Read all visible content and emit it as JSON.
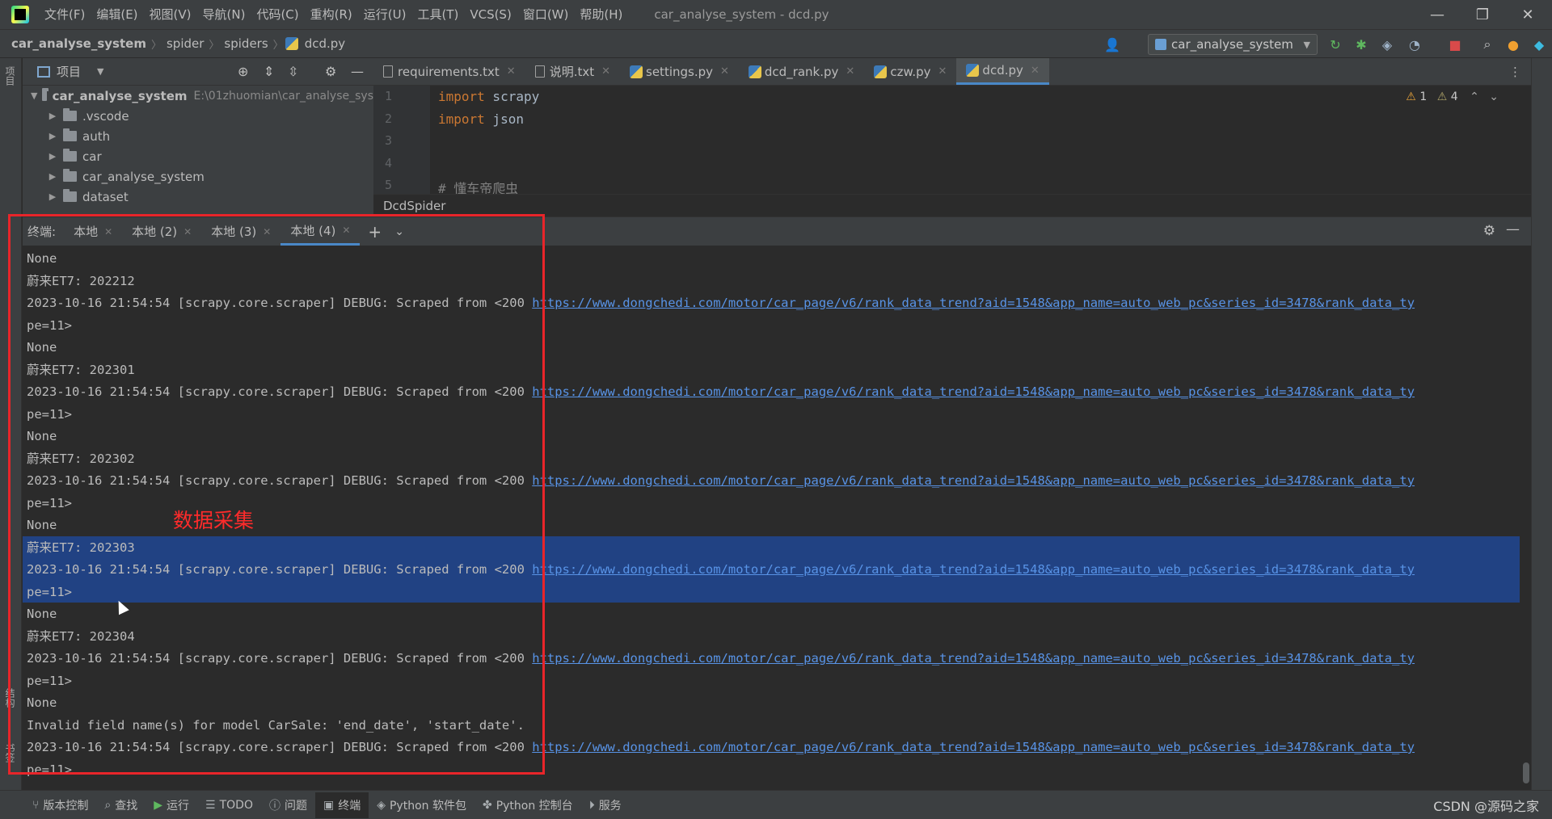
{
  "menu": {
    "items": [
      "文件(F)",
      "编辑(E)",
      "视图(V)",
      "导航(N)",
      "代码(C)",
      "重构(R)",
      "运行(U)",
      "工具(T)",
      "VCS(S)",
      "窗口(W)",
      "帮助(H)"
    ],
    "window_title": "car_analyse_system - dcd.py"
  },
  "nav": {
    "crumbs": [
      "car_analyse_system",
      "spider",
      "spiders",
      "dcd.py"
    ],
    "run_config": "car_analyse_system"
  },
  "left_strip": {
    "top_label": "项目",
    "bottom_label_1": "结构",
    "bottom_label_2": "书签"
  },
  "project": {
    "header_label": "项目",
    "root": {
      "name": "car_analyse_system",
      "path": "E:\\01zhuomian\\car_analyse_sys"
    },
    "folders": [
      ".vscode",
      "auth",
      "car",
      "car_analyse_system",
      "dataset"
    ]
  },
  "editor": {
    "tabs": [
      {
        "label": "requirements.txt",
        "icon": "text-file-icon"
      },
      {
        "label": "说明.txt",
        "icon": "text-file-icon"
      },
      {
        "label": "settings.py",
        "icon": "python-file-icon"
      },
      {
        "label": "dcd_rank.py",
        "icon": "python-file-icon"
      },
      {
        "label": "czw.py",
        "icon": "python-file-icon"
      },
      {
        "label": "dcd.py",
        "icon": "python-file-icon",
        "active": true
      }
    ],
    "line_numbers": [
      "1",
      "2",
      "3",
      "4",
      "5"
    ],
    "lines": [
      {
        "kw": "import",
        "rest": " scrapy"
      },
      {
        "kw": "import",
        "rest": " json"
      },
      {
        "kw": "",
        "rest": ""
      },
      {
        "kw": "",
        "rest": ""
      },
      {
        "kw": "",
        "rest": "# 懂车帝爬虫",
        "comment": true
      }
    ],
    "inspection": {
      "warnings": "1",
      "weak_warnings": "4"
    },
    "breadcrumb": "DcdSpider"
  },
  "terminal": {
    "label": "终端:",
    "tabs": [
      "本地",
      "本地 (2)",
      "本地 (3)",
      "本地 (4)"
    ],
    "active_tab": "本地 (4)",
    "url": "https://www.dongchedi.com/motor/car_page/v6/rank_data_trend?aid=1548&app_name=auto_web_pc&series_id=3478&rank_data_ty",
    "lines": [
      {
        "text": "None"
      },
      {
        "text": "蔚来ET7: 202212"
      },
      {
        "text": "2023-10-16 21:54:54 [scrapy.core.scraper] DEBUG: Scraped from <200 ",
        "link": true
      },
      {
        "text": "pe=11>"
      },
      {
        "text": "None"
      },
      {
        "text": "蔚来ET7: 202301"
      },
      {
        "text": "2023-10-16 21:54:54 [scrapy.core.scraper] DEBUG: Scraped from <200 ",
        "link": true
      },
      {
        "text": "pe=11>"
      },
      {
        "text": "None"
      },
      {
        "text": "蔚来ET7: 202302"
      },
      {
        "text": "2023-10-16 21:54:54 [scrapy.core.scraper] DEBUG: Scraped from <200 ",
        "link": true
      },
      {
        "text": "pe=11>"
      },
      {
        "text": "None"
      },
      {
        "text": "蔚来ET7: 202303"
      },
      {
        "text": "2023-10-16 21:54:54 [scrapy.core.scraper] DEBUG: Scraped from <200 ",
        "link": true
      },
      {
        "text": "pe=11>"
      },
      {
        "text": "None"
      },
      {
        "text": "蔚来ET7: 202304"
      },
      {
        "text": "2023-10-16 21:54:54 [scrapy.core.scraper] DEBUG: Scraped from <200 ",
        "link": true
      },
      {
        "text": "pe=11>"
      },
      {
        "text": "None"
      },
      {
        "text": "Invalid field name(s) for model CarSale: 'end_date', 'start_date'."
      },
      {
        "text": "2023-10-16 21:54:54 [scrapy.core.scraper] DEBUG: Scraped from <200 ",
        "link": true
      },
      {
        "text": "pe=11>"
      }
    ]
  },
  "annotation": {
    "text": "数据采集",
    "color": "#e8252a"
  },
  "statusbar": {
    "items": [
      {
        "icon": "branch-icon",
        "label": "版本控制"
      },
      {
        "icon": "search-icon",
        "label": "查找"
      },
      {
        "icon": "run-icon",
        "label": "运行"
      },
      {
        "icon": "list-icon",
        "label": "TODO"
      },
      {
        "icon": "info-icon",
        "label": "问题"
      },
      {
        "icon": "terminal-icon",
        "label": "终端",
        "active": true
      },
      {
        "icon": "package-icon",
        "label": "Python 软件包"
      },
      {
        "icon": "python-console-icon",
        "label": "Python 控制台"
      },
      {
        "icon": "services-icon",
        "label": "服务"
      }
    ]
  },
  "watermark": "CSDN @源码之家",
  "colors": {
    "accent": "#4a88c7",
    "link": "#5893e6",
    "selection": "#214283",
    "annotation": "#e8252a"
  }
}
